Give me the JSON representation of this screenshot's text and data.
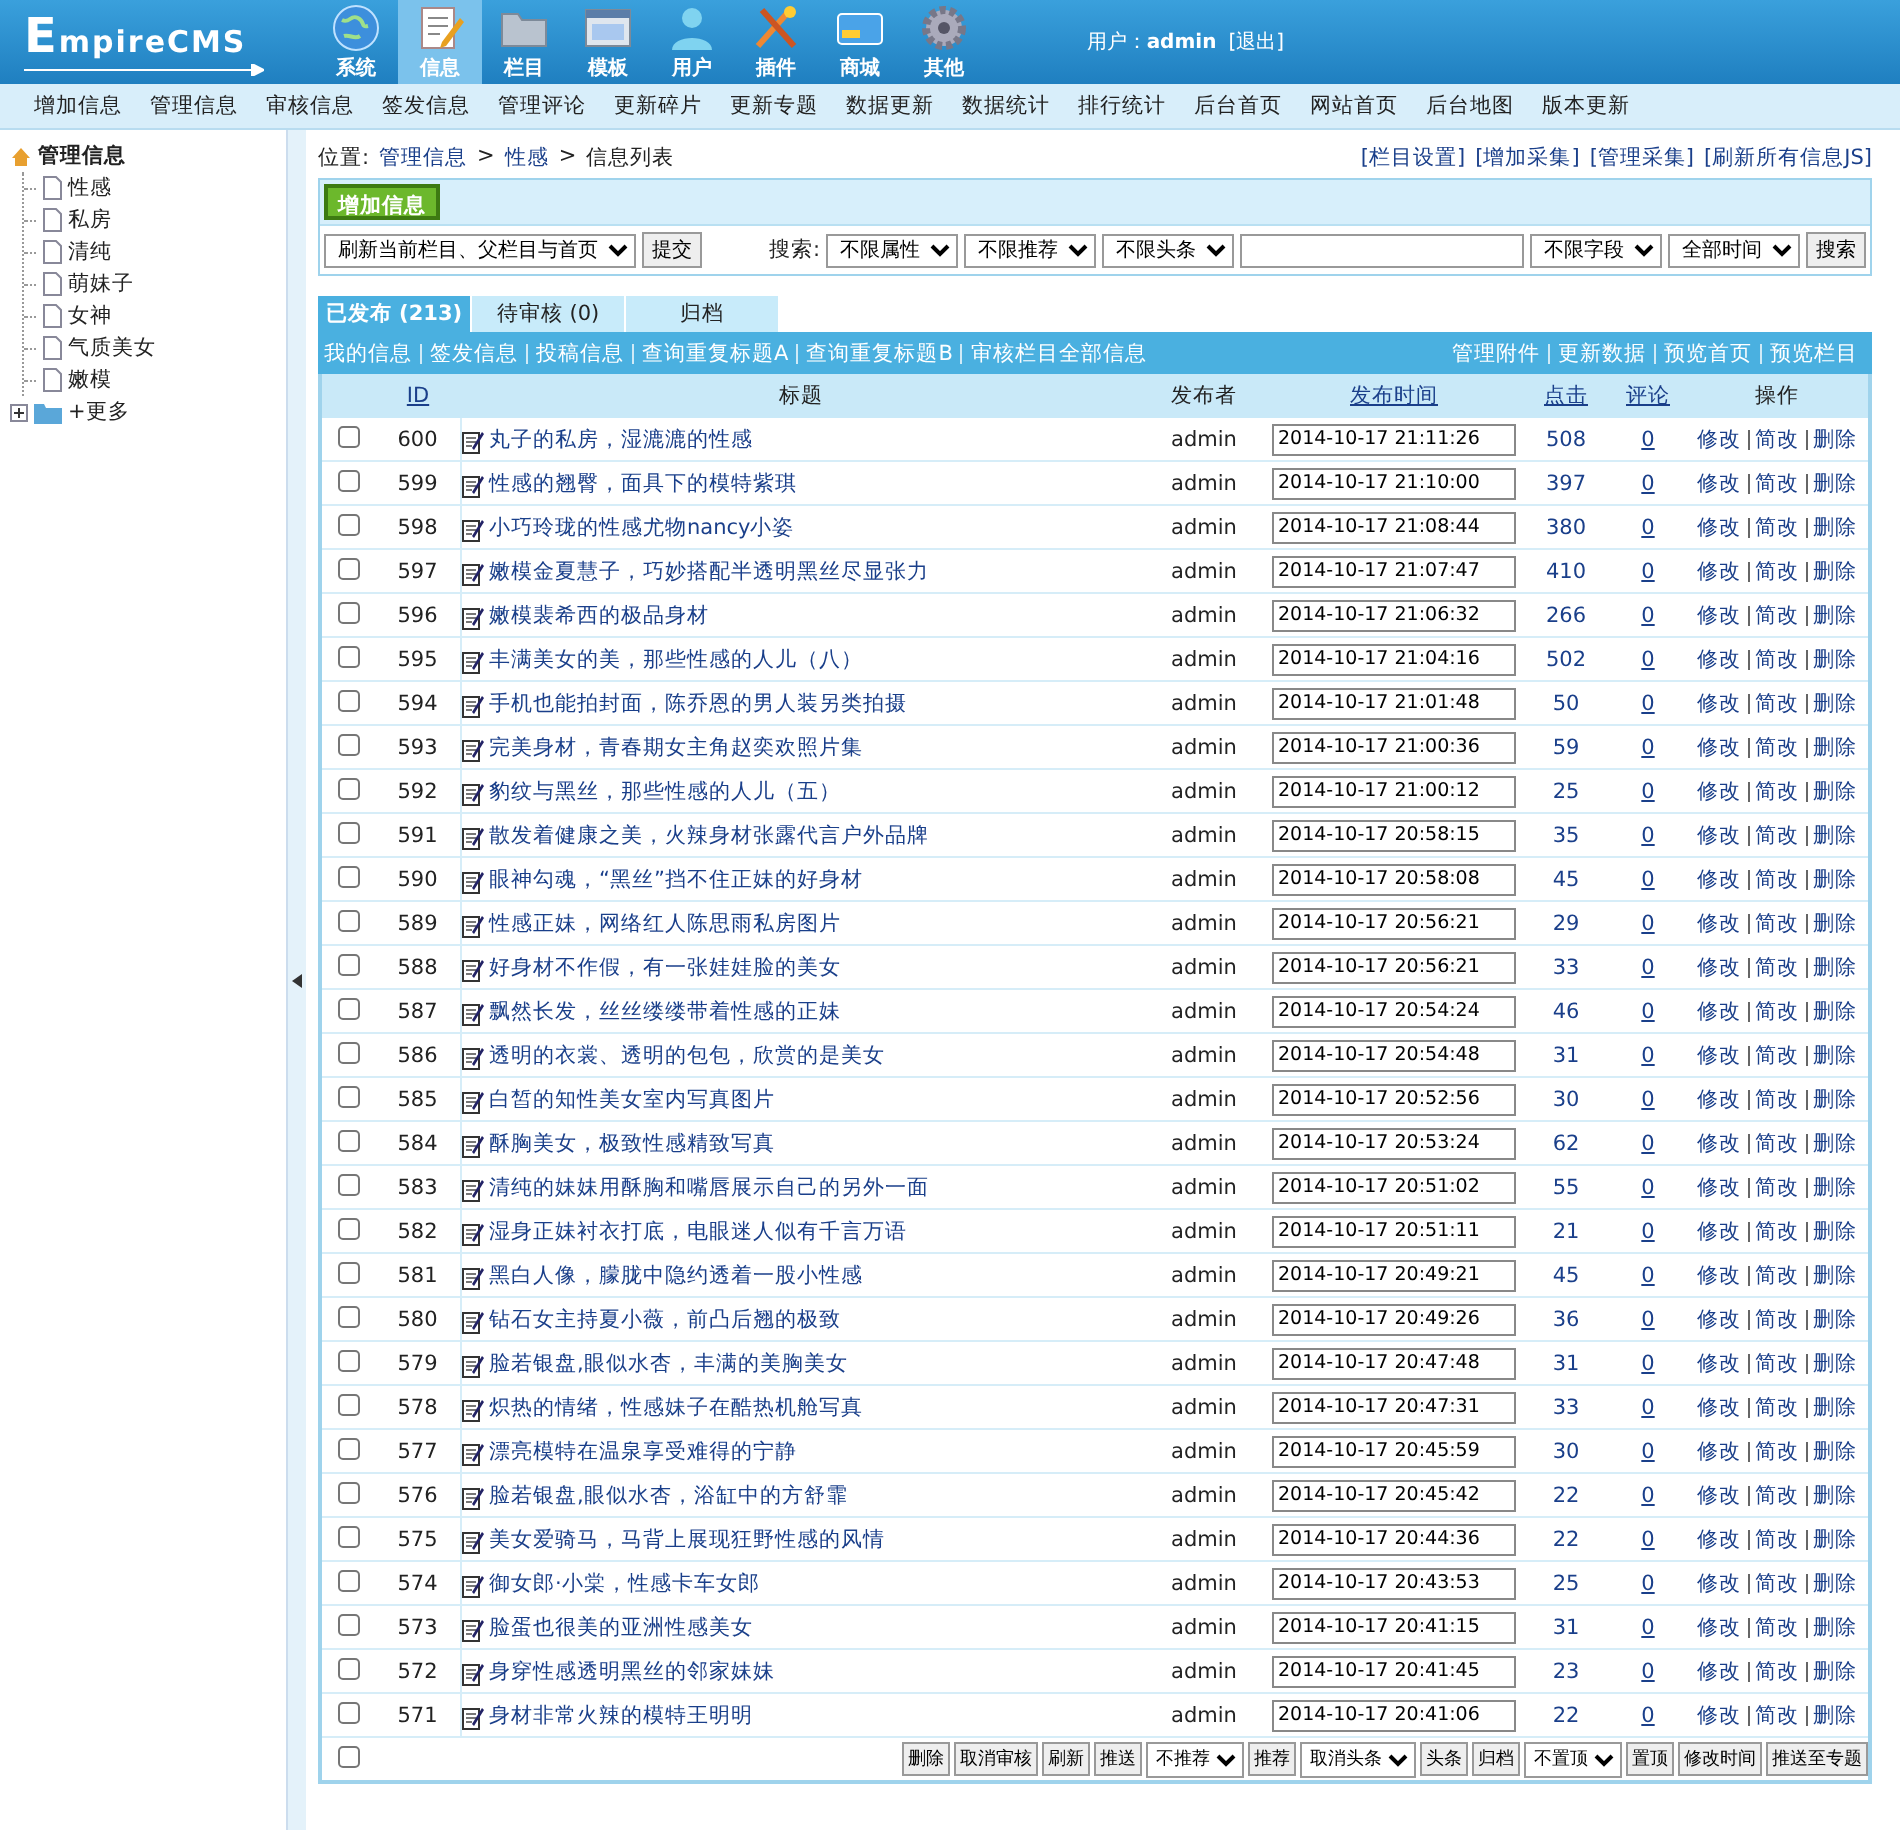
{
  "header": {
    "logo": "EmpireCMS",
    "nav": [
      {
        "label": "系统",
        "selected": false
      },
      {
        "label": "信息",
        "selected": true
      },
      {
        "label": "栏目",
        "selected": false
      },
      {
        "label": "模板",
        "selected": false
      },
      {
        "label": "用户",
        "selected": false
      },
      {
        "label": "插件",
        "selected": false
      },
      {
        "label": "商城",
        "selected": false
      },
      {
        "label": "其他",
        "selected": false
      }
    ],
    "user_label": "用户：",
    "user": "admin",
    "logout": "[退出]"
  },
  "menu": [
    "增加信息",
    "管理信息",
    "审核信息",
    "签发信息",
    "管理评论",
    "更新碎片",
    "更新专题",
    "数据更新",
    "数据统计",
    "排行统计",
    "后台首页",
    "网站首页",
    "后台地图",
    "版本更新"
  ],
  "sidebar": {
    "tree": [
      {
        "label": "管理信息",
        "expanded": true,
        "children": [
          {
            "label": "性感"
          },
          {
            "label": "私房"
          },
          {
            "label": "清纯"
          },
          {
            "label": "萌妹子"
          },
          {
            "label": "女神"
          },
          {
            "label": "气质美女"
          },
          {
            "label": "嫩模"
          }
        ]
      },
      {
        "label": "+更多",
        "expanded": false
      }
    ]
  },
  "breadcrumb": {
    "prefix": "位置:",
    "items": [
      {
        "kind": "link",
        "text": "管理信息"
      },
      {
        "kind": "sep",
        "text": ">"
      },
      {
        "kind": "link",
        "text": "性感"
      },
      {
        "kind": "sep",
        "text": ">"
      },
      {
        "kind": "plain",
        "text": "信息列表"
      }
    ]
  },
  "top_links": [
    "[栏目设置]",
    "[增加采集]",
    "[管理采集]",
    "[刷新所有信息JS]"
  ],
  "add_button": "增加信息",
  "refresh": {
    "select": "刷新当前栏目、父栏目与首页",
    "button": "提交"
  },
  "search": {
    "label": "搜索:",
    "selects_before": [
      "不限属性",
      "不限推荐",
      "不限头条"
    ],
    "selects_after": [
      "不限字段",
      "全部时间"
    ],
    "button": "搜索"
  },
  "tabs": [
    {
      "label": "已发布 (213)",
      "selected": true
    },
    {
      "label": "待审核 (0)",
      "selected": false
    },
    {
      "label": "归档",
      "selected": false
    }
  ],
  "links_left": [
    "我的信息",
    "签发信息",
    "投稿信息",
    "查询重复标题A",
    "查询重复标题B",
    "审核栏目全部信息"
  ],
  "links_right": [
    "管理附件",
    "更新数据",
    "预览首页",
    "预览栏目"
  ],
  "columns": [
    {
      "label": "ID",
      "sortable": true
    },
    {
      "label": "标题",
      "sortable": false
    },
    {
      "label": "发布者",
      "sortable": false
    },
    {
      "label": "发布时间",
      "sortable": true
    },
    {
      "label": "点击",
      "sortable": true
    },
    {
      "label": "评论",
      "sortable": true
    },
    {
      "label": "操作",
      "sortable": false
    }
  ],
  "rows": [
    {
      "checked": false,
      "id": "600",
      "title": "丸子的私房，湿漉漉的性感",
      "author": "admin",
      "time": "2014-10-17 21:11:26",
      "clicks": "508",
      "comments": "0",
      "actions": [
        "修改",
        "简改",
        "删除"
      ]
    },
    {
      "checked": false,
      "id": "599",
      "title": "性感的翘臀，面具下的模特紫琪",
      "author": "admin",
      "time": "2014-10-17 21:10:00",
      "clicks": "397",
      "comments": "0",
      "actions": [
        "修改",
        "简改",
        "删除"
      ]
    },
    {
      "checked": false,
      "id": "598",
      "title": "小巧玲珑的性感尤物nancy小姿",
      "author": "admin",
      "time": "2014-10-17 21:08:44",
      "clicks": "380",
      "comments": "0",
      "actions": [
        "修改",
        "简改",
        "删除"
      ]
    },
    {
      "checked": false,
      "id": "597",
      "title": "嫩模金夏慧子，巧妙搭配半透明黑丝尽显张力",
      "author": "admin",
      "time": "2014-10-17 21:07:47",
      "clicks": "410",
      "comments": "0",
      "actions": [
        "修改",
        "简改",
        "删除"
      ]
    },
    {
      "checked": false,
      "id": "596",
      "title": "嫩模裴希西的极品身材",
      "author": "admin",
      "time": "2014-10-17 21:06:32",
      "clicks": "266",
      "comments": "0",
      "actions": [
        "修改",
        "简改",
        "删除"
      ]
    },
    {
      "checked": false,
      "id": "595",
      "title": "丰满美女的美，那些性感的人儿（八）",
      "author": "admin",
      "time": "2014-10-17 21:04:16",
      "clicks": "502",
      "comments": "0",
      "actions": [
        "修改",
        "简改",
        "删除"
      ]
    },
    {
      "checked": false,
      "id": "594",
      "title": "手机也能拍封面，陈乔恩的男人装另类拍摄",
      "author": "admin",
      "time": "2014-10-17 21:01:48",
      "clicks": "50",
      "comments": "0",
      "actions": [
        "修改",
        "简改",
        "删除"
      ]
    },
    {
      "checked": false,
      "id": "593",
      "title": "完美身材，青春期女主角赵奕欢照片集",
      "author": "admin",
      "time": "2014-10-17 21:00:36",
      "clicks": "59",
      "comments": "0",
      "actions": [
        "修改",
        "简改",
        "删除"
      ]
    },
    {
      "checked": false,
      "id": "592",
      "title": "豹纹与黑丝，那些性感的人儿（五）",
      "author": "admin",
      "time": "2014-10-17 21:00:12",
      "clicks": "25",
      "comments": "0",
      "actions": [
        "修改",
        "简改",
        "删除"
      ]
    },
    {
      "checked": false,
      "id": "591",
      "title": "散发着健康之美，火辣身材张露代言户外品牌",
      "author": "admin",
      "time": "2014-10-17 20:58:15",
      "clicks": "35",
      "comments": "0",
      "actions": [
        "修改",
        "简改",
        "删除"
      ]
    },
    {
      "checked": false,
      "id": "590",
      "title": "眼神勾魂，“黑丝”挡不住正妹的好身材",
      "author": "admin",
      "time": "2014-10-17 20:58:08",
      "clicks": "45",
      "comments": "0",
      "actions": [
        "修改",
        "简改",
        "删除"
      ]
    },
    {
      "checked": false,
      "id": "589",
      "title": "性感正妹，网络红人陈思雨私房图片",
      "author": "admin",
      "time": "2014-10-17 20:56:21",
      "clicks": "29",
      "comments": "0",
      "actions": [
        "修改",
        "简改",
        "删除"
      ]
    },
    {
      "checked": false,
      "id": "588",
      "title": "好身材不作假，有一张娃娃脸的美女",
      "author": "admin",
      "time": "2014-10-17 20:56:21",
      "clicks": "33",
      "comments": "0",
      "actions": [
        "修改",
        "简改",
        "删除"
      ]
    },
    {
      "checked": false,
      "id": "587",
      "title": "飘然长发，丝丝缕缕带着性感的正妹",
      "author": "admin",
      "time": "2014-10-17 20:54:24",
      "clicks": "46",
      "comments": "0",
      "actions": [
        "修改",
        "简改",
        "删除"
      ]
    },
    {
      "checked": false,
      "id": "586",
      "title": "透明的衣裳、透明的包包，欣赏的是美女",
      "author": "admin",
      "time": "2014-10-17 20:54:48",
      "clicks": "31",
      "comments": "0",
      "actions": [
        "修改",
        "简改",
        "删除"
      ]
    },
    {
      "checked": false,
      "id": "585",
      "title": "白皙的知性美女室内写真图片",
      "author": "admin",
      "time": "2014-10-17 20:52:56",
      "clicks": "30",
      "comments": "0",
      "actions": [
        "修改",
        "简改",
        "删除"
      ]
    },
    {
      "checked": false,
      "id": "584",
      "title": "酥胸美女，极致性感精致写真",
      "author": "admin",
      "time": "2014-10-17 20:53:24",
      "clicks": "62",
      "comments": "0",
      "actions": [
        "修改",
        "简改",
        "删除"
      ]
    },
    {
      "checked": false,
      "id": "583",
      "title": "清纯的妹妹用酥胸和嘴唇展示自己的另外一面",
      "author": "admin",
      "time": "2014-10-17 20:51:02",
      "clicks": "55",
      "comments": "0",
      "actions": [
        "修改",
        "简改",
        "删除"
      ]
    },
    {
      "checked": false,
      "id": "582",
      "title": "湿身正妹衬衣打底，电眼迷人似有千言万语",
      "author": "admin",
      "time": "2014-10-17 20:51:11",
      "clicks": "21",
      "comments": "0",
      "actions": [
        "修改",
        "简改",
        "删除"
      ]
    },
    {
      "checked": false,
      "id": "581",
      "title": "黑白人像，朦胧中隐约透着一股小性感",
      "author": "admin",
      "time": "2014-10-17 20:49:21",
      "clicks": "45",
      "comments": "0",
      "actions": [
        "修改",
        "简改",
        "删除"
      ]
    },
    {
      "checked": false,
      "id": "580",
      "title": "钻石女主持夏小薇，前凸后翘的极致",
      "author": "admin",
      "time": "2014-10-17 20:49:26",
      "clicks": "36",
      "comments": "0",
      "actions": [
        "修改",
        "简改",
        "删除"
      ]
    },
    {
      "checked": false,
      "id": "579",
      "title": "脸若银盘,眼似水杏，丰满的美胸美女",
      "author": "admin",
      "time": "2014-10-17 20:47:48",
      "clicks": "31",
      "comments": "0",
      "actions": [
        "修改",
        "简改",
        "删除"
      ]
    },
    {
      "checked": false,
      "id": "578",
      "title": "炽热的情绪，性感妹子在酷热机舱写真",
      "author": "admin",
      "time": "2014-10-17 20:47:31",
      "clicks": "33",
      "comments": "0",
      "actions": [
        "修改",
        "简改",
        "删除"
      ]
    },
    {
      "checked": false,
      "id": "577",
      "title": "漂亮模特在温泉享受难得的宁静",
      "author": "admin",
      "time": "2014-10-17 20:45:59",
      "clicks": "30",
      "comments": "0",
      "actions": [
        "修改",
        "简改",
        "删除"
      ]
    },
    {
      "checked": false,
      "id": "576",
      "title": "脸若银盘,眼似水杏，浴缸中的方舒霏",
      "author": "admin",
      "time": "2014-10-17 20:45:42",
      "clicks": "22",
      "comments": "0",
      "actions": [
        "修改",
        "简改",
        "删除"
      ]
    },
    {
      "checked": false,
      "id": "575",
      "title": "美女爱骑马，马背上展现狂野性感的风情",
      "author": "admin",
      "time": "2014-10-17 20:44:36",
      "clicks": "22",
      "comments": "0",
      "actions": [
        "修改",
        "简改",
        "删除"
      ]
    },
    {
      "checked": false,
      "id": "574",
      "title": "御女郎·小棠，性感卡车女郎",
      "author": "admin",
      "time": "2014-10-17 20:43:53",
      "clicks": "25",
      "comments": "0",
      "actions": [
        "修改",
        "简改",
        "删除"
      ]
    },
    {
      "checked": false,
      "id": "573",
      "title": "脸蛋也很美的亚洲性感美女",
      "author": "admin",
      "time": "2014-10-17 20:41:15",
      "clicks": "31",
      "comments": "0",
      "actions": [
        "修改",
        "简改",
        "删除"
      ]
    },
    {
      "checked": false,
      "id": "572",
      "title": "身穿性感透明黑丝的邻家妹妹",
      "author": "admin",
      "time": "2014-10-17 20:41:45",
      "clicks": "23",
      "comments": "0",
      "actions": [
        "修改",
        "简改",
        "删除"
      ]
    },
    {
      "checked": false,
      "id": "571",
      "title": "身材非常火辣的模特王明明",
      "author": "admin",
      "time": "2014-10-17 20:41:06",
      "clicks": "22",
      "comments": "0",
      "actions": [
        "修改",
        "简改",
        "删除"
      ]
    }
  ],
  "bulk": {
    "checked": false,
    "controls": [
      {
        "kind": "button",
        "text": "删除"
      },
      {
        "kind": "button",
        "text": "取消审核"
      },
      {
        "kind": "button",
        "text": "刷新"
      },
      {
        "kind": "button",
        "text": "推送"
      },
      {
        "kind": "select",
        "text": "不推荐"
      },
      {
        "kind": "button",
        "text": "推荐"
      },
      {
        "kind": "select",
        "text": "取消头条"
      },
      {
        "kind": "button",
        "text": "头条"
      },
      {
        "kind": "button",
        "text": "归档"
      },
      {
        "kind": "select",
        "text": "不置顶"
      },
      {
        "kind": "button",
        "text": "置顶"
      },
      {
        "kind": "button",
        "text": "修改时间"
      },
      {
        "kind": "button",
        "text": "推送至专题"
      }
    ]
  }
}
